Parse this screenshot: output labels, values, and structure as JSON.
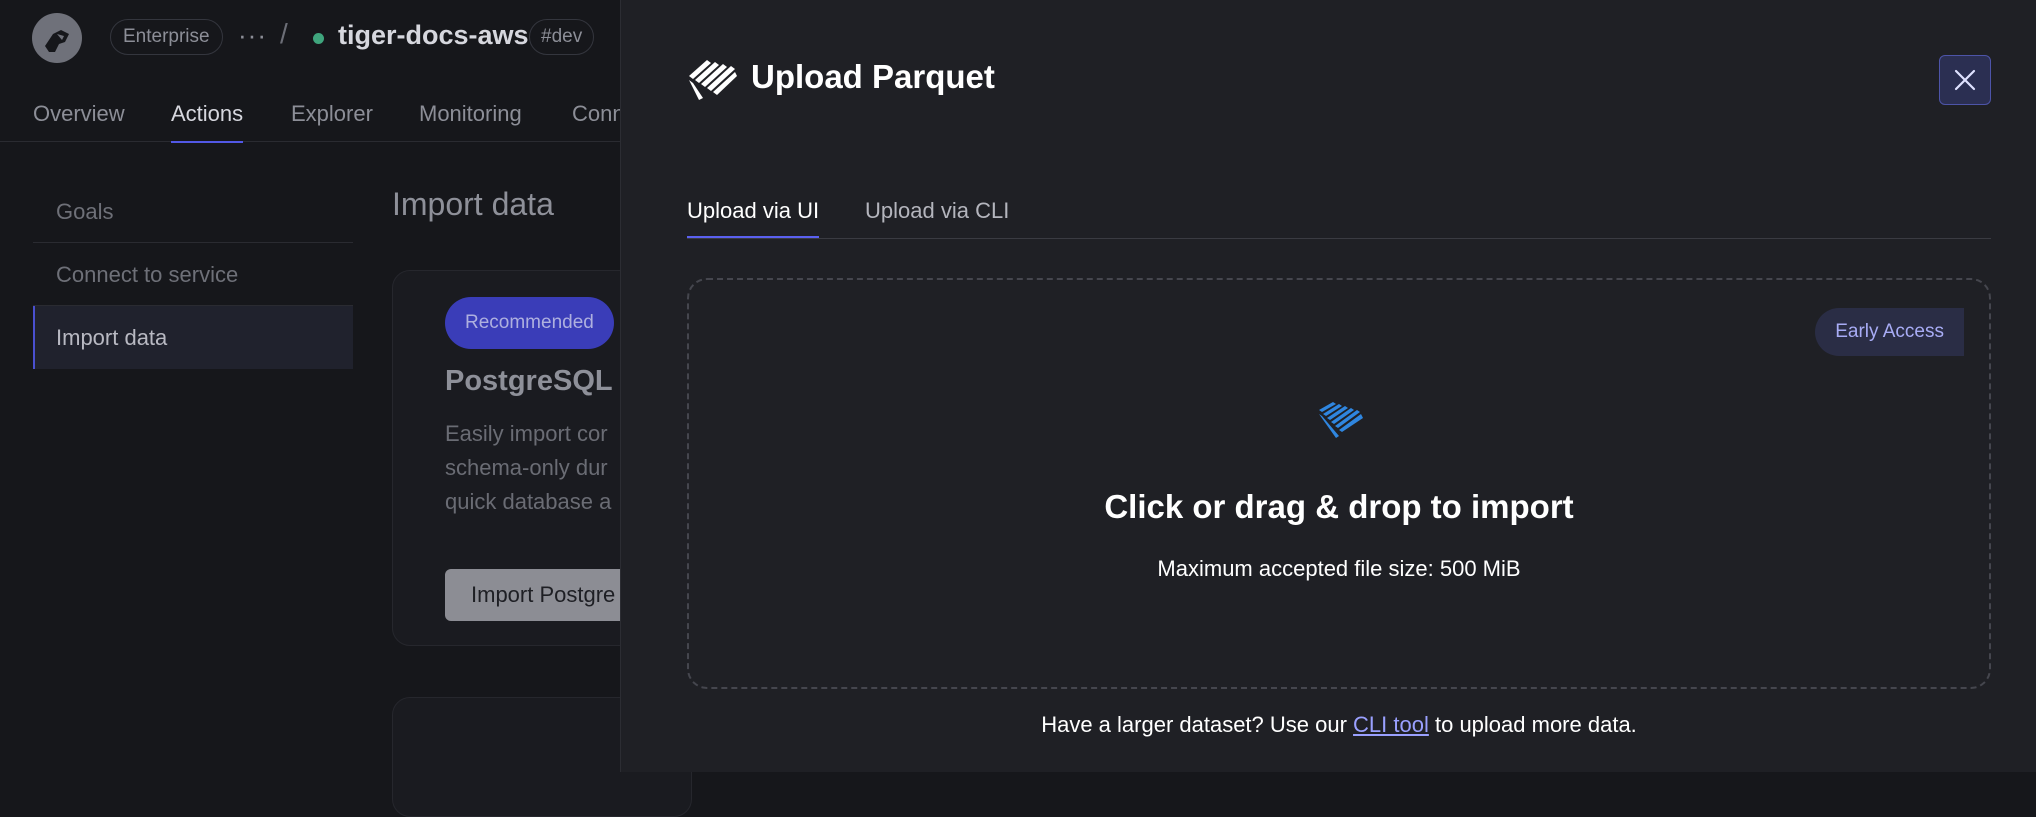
{
  "header": {
    "plan": "Enterprise",
    "more": "···",
    "separator": "/",
    "service_name": "tiger-docs-aws",
    "env_tag": "#dev",
    "status_color": "#3fa57d"
  },
  "nav": {
    "tabs": [
      {
        "label": "Overview"
      },
      {
        "label": "Actions"
      },
      {
        "label": "Explorer"
      },
      {
        "label": "Monitoring"
      },
      {
        "label": "Conn"
      }
    ],
    "active": "Actions"
  },
  "sidebar": {
    "items": [
      {
        "label": "Goals"
      },
      {
        "label": "Connect to service"
      },
      {
        "label": "Import data"
      }
    ],
    "active": "Import data"
  },
  "main": {
    "title": "Import data",
    "card": {
      "badge": "Recommended",
      "title": "PostgreSQL I",
      "desc_lines": [
        "Easily import cor",
        "schema-only dur",
        "quick database a"
      ],
      "button": "Import Postgre"
    }
  },
  "drawer": {
    "title": "Upload Parquet",
    "icon": "parquet-logo-icon",
    "tabs": [
      {
        "label": "Upload via UI"
      },
      {
        "label": "Upload via CLI"
      }
    ],
    "active_tab": "Upload via UI",
    "dropzone": {
      "badge": "Early Access",
      "title": "Click or drag & drop to import",
      "subtitle": "Maximum accepted file size: 500 MiB"
    },
    "footer": {
      "before": "Have a larger dataset? Use our ",
      "link": "CLI tool",
      "after": " to upload more data."
    },
    "accent": "#5a60f0",
    "icon_blue": "#2f86e0"
  }
}
